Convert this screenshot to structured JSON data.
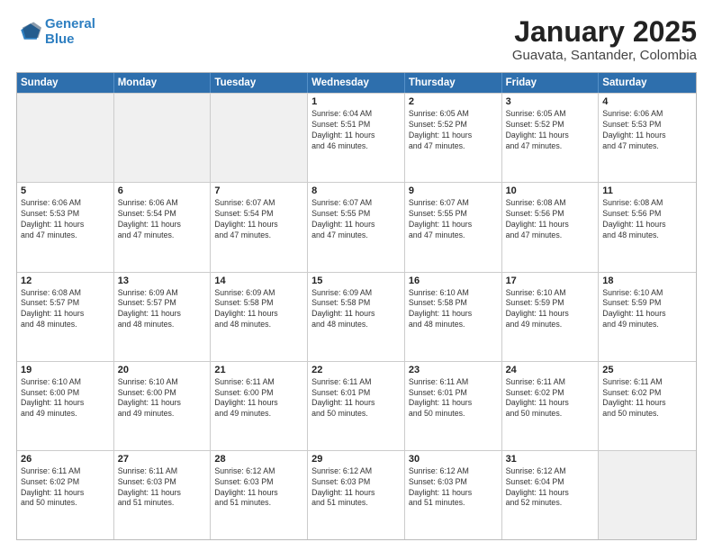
{
  "logo": {
    "line1": "General",
    "line2": "Blue"
  },
  "title": "January 2025",
  "subtitle": "Guavata, Santander, Colombia",
  "header_days": [
    "Sunday",
    "Monday",
    "Tuesday",
    "Wednesday",
    "Thursday",
    "Friday",
    "Saturday"
  ],
  "weeks": [
    [
      {
        "day": "",
        "info": "",
        "shaded": true
      },
      {
        "day": "",
        "info": "",
        "shaded": true
      },
      {
        "day": "",
        "info": "",
        "shaded": true
      },
      {
        "day": "1",
        "info": "Sunrise: 6:04 AM\nSunset: 5:51 PM\nDaylight: 11 hours\nand 46 minutes.",
        "shaded": false
      },
      {
        "day": "2",
        "info": "Sunrise: 6:05 AM\nSunset: 5:52 PM\nDaylight: 11 hours\nand 47 minutes.",
        "shaded": false
      },
      {
        "day": "3",
        "info": "Sunrise: 6:05 AM\nSunset: 5:52 PM\nDaylight: 11 hours\nand 47 minutes.",
        "shaded": false
      },
      {
        "day": "4",
        "info": "Sunrise: 6:06 AM\nSunset: 5:53 PM\nDaylight: 11 hours\nand 47 minutes.",
        "shaded": false
      }
    ],
    [
      {
        "day": "5",
        "info": "Sunrise: 6:06 AM\nSunset: 5:53 PM\nDaylight: 11 hours\nand 47 minutes.",
        "shaded": false
      },
      {
        "day": "6",
        "info": "Sunrise: 6:06 AM\nSunset: 5:54 PM\nDaylight: 11 hours\nand 47 minutes.",
        "shaded": false
      },
      {
        "day": "7",
        "info": "Sunrise: 6:07 AM\nSunset: 5:54 PM\nDaylight: 11 hours\nand 47 minutes.",
        "shaded": false
      },
      {
        "day": "8",
        "info": "Sunrise: 6:07 AM\nSunset: 5:55 PM\nDaylight: 11 hours\nand 47 minutes.",
        "shaded": false
      },
      {
        "day": "9",
        "info": "Sunrise: 6:07 AM\nSunset: 5:55 PM\nDaylight: 11 hours\nand 47 minutes.",
        "shaded": false
      },
      {
        "day": "10",
        "info": "Sunrise: 6:08 AM\nSunset: 5:56 PM\nDaylight: 11 hours\nand 47 minutes.",
        "shaded": false
      },
      {
        "day": "11",
        "info": "Sunrise: 6:08 AM\nSunset: 5:56 PM\nDaylight: 11 hours\nand 48 minutes.",
        "shaded": false
      }
    ],
    [
      {
        "day": "12",
        "info": "Sunrise: 6:08 AM\nSunset: 5:57 PM\nDaylight: 11 hours\nand 48 minutes.",
        "shaded": false
      },
      {
        "day": "13",
        "info": "Sunrise: 6:09 AM\nSunset: 5:57 PM\nDaylight: 11 hours\nand 48 minutes.",
        "shaded": false
      },
      {
        "day": "14",
        "info": "Sunrise: 6:09 AM\nSunset: 5:58 PM\nDaylight: 11 hours\nand 48 minutes.",
        "shaded": false
      },
      {
        "day": "15",
        "info": "Sunrise: 6:09 AM\nSunset: 5:58 PM\nDaylight: 11 hours\nand 48 minutes.",
        "shaded": false
      },
      {
        "day": "16",
        "info": "Sunrise: 6:10 AM\nSunset: 5:58 PM\nDaylight: 11 hours\nand 48 minutes.",
        "shaded": false
      },
      {
        "day": "17",
        "info": "Sunrise: 6:10 AM\nSunset: 5:59 PM\nDaylight: 11 hours\nand 49 minutes.",
        "shaded": false
      },
      {
        "day": "18",
        "info": "Sunrise: 6:10 AM\nSunset: 5:59 PM\nDaylight: 11 hours\nand 49 minutes.",
        "shaded": false
      }
    ],
    [
      {
        "day": "19",
        "info": "Sunrise: 6:10 AM\nSunset: 6:00 PM\nDaylight: 11 hours\nand 49 minutes.",
        "shaded": false
      },
      {
        "day": "20",
        "info": "Sunrise: 6:10 AM\nSunset: 6:00 PM\nDaylight: 11 hours\nand 49 minutes.",
        "shaded": false
      },
      {
        "day": "21",
        "info": "Sunrise: 6:11 AM\nSunset: 6:00 PM\nDaylight: 11 hours\nand 49 minutes.",
        "shaded": false
      },
      {
        "day": "22",
        "info": "Sunrise: 6:11 AM\nSunset: 6:01 PM\nDaylight: 11 hours\nand 50 minutes.",
        "shaded": false
      },
      {
        "day": "23",
        "info": "Sunrise: 6:11 AM\nSunset: 6:01 PM\nDaylight: 11 hours\nand 50 minutes.",
        "shaded": false
      },
      {
        "day": "24",
        "info": "Sunrise: 6:11 AM\nSunset: 6:02 PM\nDaylight: 11 hours\nand 50 minutes.",
        "shaded": false
      },
      {
        "day": "25",
        "info": "Sunrise: 6:11 AM\nSunset: 6:02 PM\nDaylight: 11 hours\nand 50 minutes.",
        "shaded": false
      }
    ],
    [
      {
        "day": "26",
        "info": "Sunrise: 6:11 AM\nSunset: 6:02 PM\nDaylight: 11 hours\nand 50 minutes.",
        "shaded": false
      },
      {
        "day": "27",
        "info": "Sunrise: 6:11 AM\nSunset: 6:03 PM\nDaylight: 11 hours\nand 51 minutes.",
        "shaded": false
      },
      {
        "day": "28",
        "info": "Sunrise: 6:12 AM\nSunset: 6:03 PM\nDaylight: 11 hours\nand 51 minutes.",
        "shaded": false
      },
      {
        "day": "29",
        "info": "Sunrise: 6:12 AM\nSunset: 6:03 PM\nDaylight: 11 hours\nand 51 minutes.",
        "shaded": false
      },
      {
        "day": "30",
        "info": "Sunrise: 6:12 AM\nSunset: 6:03 PM\nDaylight: 11 hours\nand 51 minutes.",
        "shaded": false
      },
      {
        "day": "31",
        "info": "Sunrise: 6:12 AM\nSunset: 6:04 PM\nDaylight: 11 hours\nand 52 minutes.",
        "shaded": false
      },
      {
        "day": "",
        "info": "",
        "shaded": true
      }
    ]
  ]
}
